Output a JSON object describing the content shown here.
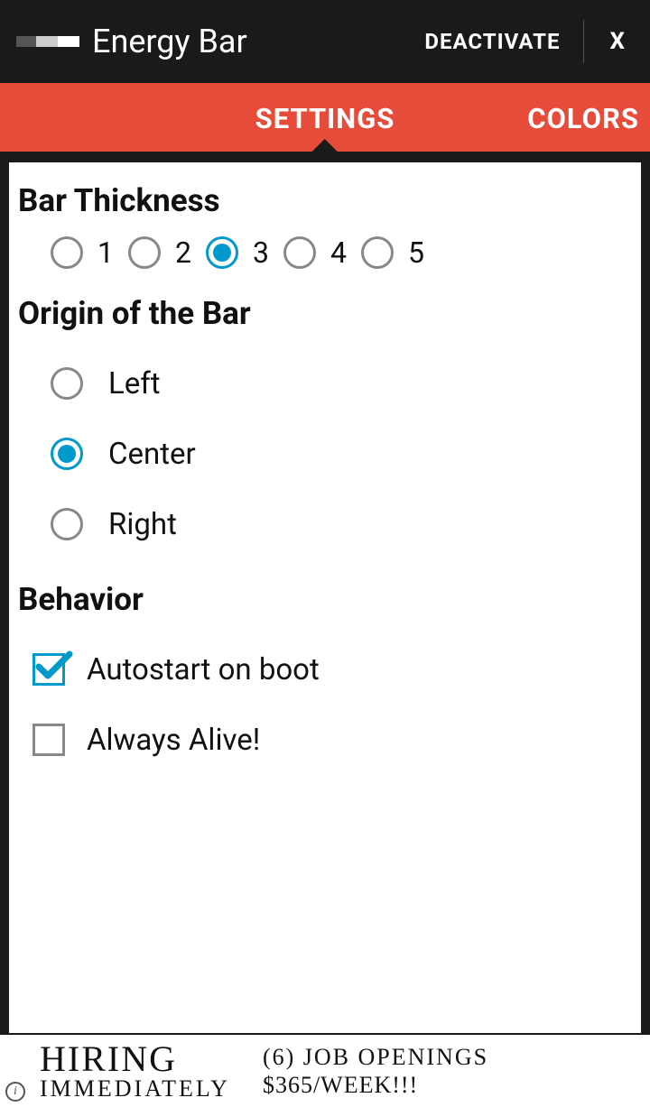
{
  "header": {
    "app_title": "Energy Bar",
    "deactivate_label": "DEACTIVATE",
    "close_label": "X"
  },
  "tabs": {
    "settings_label": "SETTINGS",
    "colors_label": "COLORS",
    "active": "settings"
  },
  "sections": {
    "thickness": {
      "heading": "Bar Thickness",
      "options": [
        "1",
        "2",
        "3",
        "4",
        "5"
      ],
      "selected": "3"
    },
    "origin": {
      "heading": "Origin of the Bar",
      "options": [
        {
          "label": "Left",
          "selected": false
        },
        {
          "label": "Center",
          "selected": true
        },
        {
          "label": "Right",
          "selected": false
        }
      ]
    },
    "behavior": {
      "heading": "Behavior",
      "options": [
        {
          "label": "Autostart on boot",
          "checked": true
        },
        {
          "label": "Always Alive!",
          "checked": false
        }
      ]
    }
  },
  "ad": {
    "hiring": "HIRING",
    "immediately": "IMMEDIATELY",
    "openings": "(6) JOB OPENINGS",
    "pay": "$365/WEEK!!!"
  }
}
